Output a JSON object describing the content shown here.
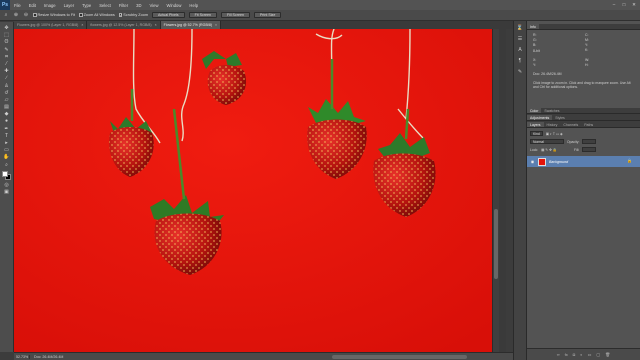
{
  "app": {
    "logo": "Ps"
  },
  "menu": [
    "File",
    "Edit",
    "Image",
    "Layer",
    "Type",
    "Select",
    "Filter",
    "3D",
    "View",
    "Window",
    "Help"
  ],
  "window_controls": [
    "–",
    "□",
    "✕"
  ],
  "options": {
    "resize_windows": "Resize Windows to Fit",
    "zoom_all": "Zoom All Windows",
    "scrubby": "Scrubby Zoom",
    "actual_pixels": "Actual Pixels",
    "fit_screen": "Fit Screen",
    "fill_screen": "Fill Screen",
    "print_size": "Print Size",
    "workspace": "Essentials"
  },
  "doc_tabs": [
    {
      "label": "Flowers.jpg @ 100% (Layer 1, RGB/8)",
      "active": false
    },
    {
      "label": "flowers.jpg @ 12.5% (Layer 1, RGB/8)",
      "active": false
    },
    {
      "label": "Flowers.jpg @ 52.7% (RGB/8)",
      "active": true
    }
  ],
  "status": {
    "zoom": "52.73%",
    "doc": "Doc: 26.4M/26.4M"
  },
  "panels": {
    "info_tab": "Info",
    "info_values": {
      "r": "R:",
      "g": "G:",
      "b": "B:",
      "bits": "8-bit",
      "c": "C:",
      "m": "M:",
      "y": "Y:",
      "k": "K:",
      "x": "X:",
      "yy": "Y:",
      "w": "W:",
      "h": "H:"
    },
    "doc_info": "Doc: 26.4M/26.4M",
    "info_note": "Click image to zoom in. Click and drag to marquee zoom. Use Alt and Ctrl for additional options.",
    "color_tabs": [
      "Color",
      "Swatches"
    ],
    "adj_tabs": [
      "Adjustments",
      "Styles"
    ],
    "layer_tabs": [
      "Layers",
      "History",
      "Channels",
      "Paths"
    ],
    "kind_label": "Kind",
    "blend_mode": "Normal",
    "opacity_label": "Opacity:",
    "lock_label": "Lock:",
    "fill_label": "Fill:",
    "layer_name": "Background"
  }
}
